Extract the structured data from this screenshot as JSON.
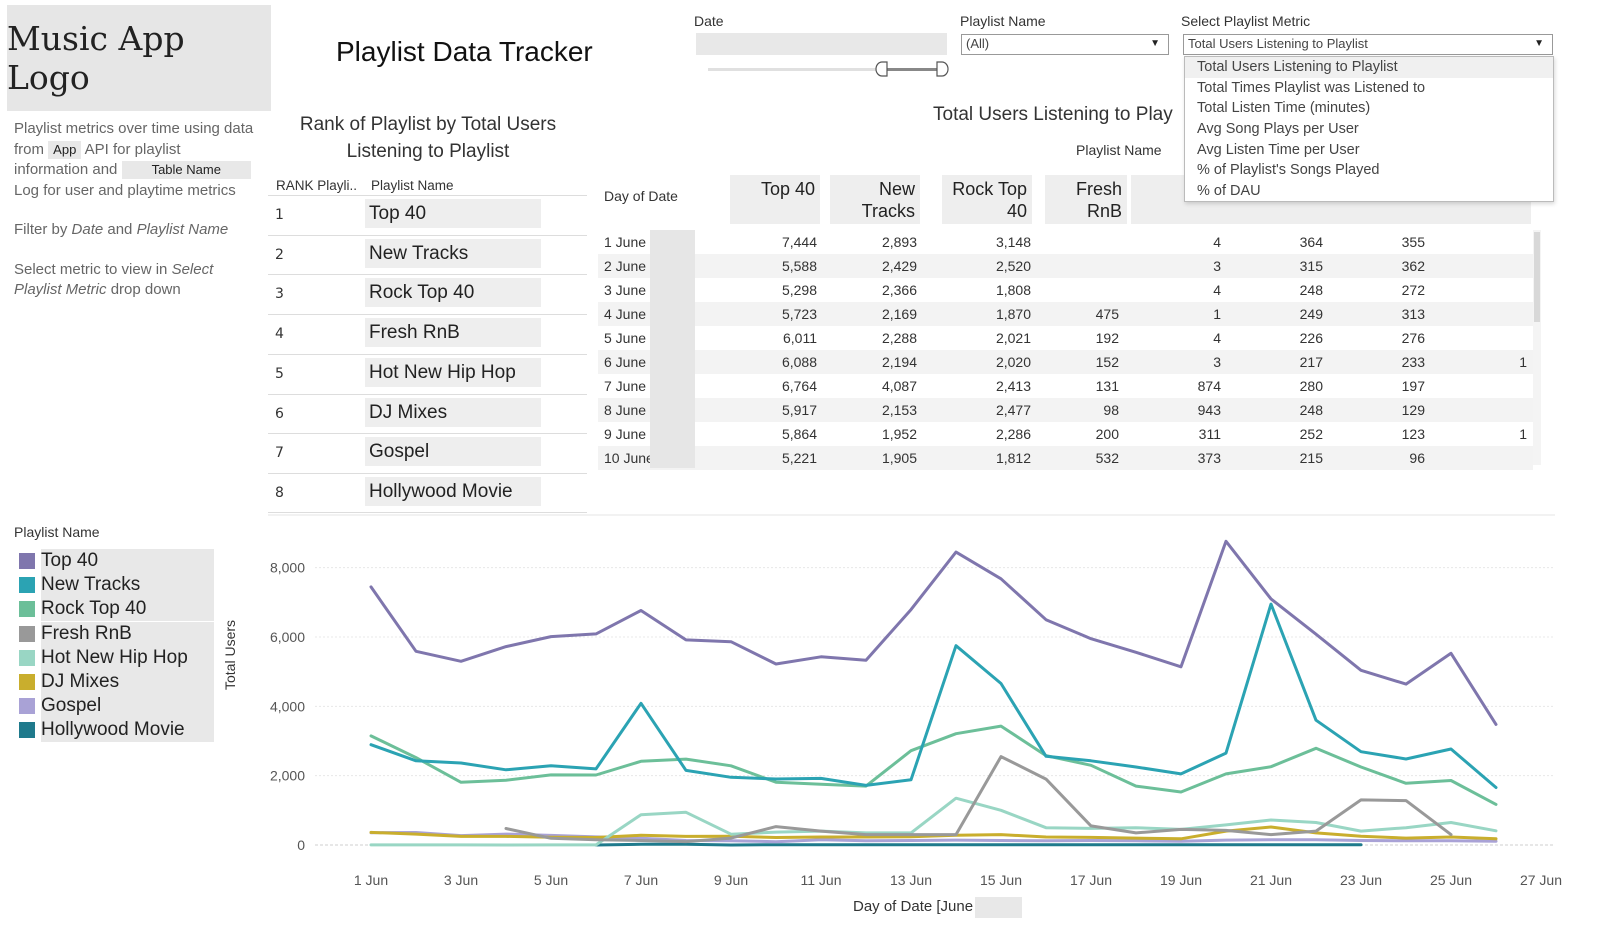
{
  "logo": {
    "text": "Music App Logo"
  },
  "title": "Playlist Data Tracker",
  "description": {
    "p1_a": "Playlist metrics over time using data from",
    "p1_chip1": "App",
    "p1_b": "API for playlist information and",
    "p1_chip2": "Table Name",
    "p1_c": "Log for user and playtime metrics",
    "p2_a": "Filter by",
    "p2_date": "Date",
    "p2_and": "and",
    "p2_pn": "Playlist Name",
    "p3_a": "Select metric to view in",
    "p3_sm": "Select Playlist Metric",
    "p3_b": "drop down"
  },
  "filters": {
    "date_label": "Date",
    "playlist_label": "Playlist Name",
    "playlist_value": "(All)",
    "metric_label": "Select Playlist Metric",
    "metric_value": "Total Users Listening to Playlist"
  },
  "metric_options": [
    "Total Users Listening to Playlist",
    "Total Times Playlist was Listened to",
    "Total Listen Time (minutes)",
    "Avg Song Plays per User",
    "Avg Listen Time per User",
    "% of Playlist's Songs Played",
    "% of DAU"
  ],
  "rank": {
    "title_l1": "Rank of Playlist by Total Users",
    "title_l2": "Listening to Playlist",
    "col_rank": "RANK Playli..",
    "col_name": "Playlist Name",
    "rows": [
      {
        "rank": "1",
        "name": "Top 40"
      },
      {
        "rank": "2",
        "name": "New Tracks"
      },
      {
        "rank": "3",
        "name": "Rock Top 40"
      },
      {
        "rank": "4",
        "name": "Fresh RnB"
      },
      {
        "rank": "5",
        "name": "Hot New Hip Hop"
      },
      {
        "rank": "6",
        "name": "DJ Mixes"
      },
      {
        "rank": "7",
        "name": "Gospel"
      },
      {
        "rank": "8",
        "name": "Hollywood Movie"
      }
    ]
  },
  "crosstab": {
    "title": "Total Users Listening to Play",
    "playlist_name_label": "Playlist Name",
    "day_label": "Day of Date",
    "col_headers": [
      [
        "Top 40"
      ],
      [
        "New",
        "Tracks"
      ],
      [
        "Rock Top",
        "40"
      ],
      [
        "Fresh",
        "RnB"
      ]
    ],
    "rows": [
      {
        "date": "1 June",
        "v": [
          "7,444",
          "2,893",
          "3,148",
          "",
          "4",
          "364",
          "355",
          ""
        ]
      },
      {
        "date": "2 June",
        "v": [
          "5,588",
          "2,429",
          "2,520",
          "",
          "3",
          "315",
          "362",
          ""
        ]
      },
      {
        "date": "3 June",
        "v": [
          "5,298",
          "2,366",
          "1,808",
          "",
          "4",
          "248",
          "272",
          ""
        ]
      },
      {
        "date": "4 June",
        "v": [
          "5,723",
          "2,169",
          "1,870",
          "475",
          "1",
          "249",
          "313",
          ""
        ]
      },
      {
        "date": "5 June",
        "v": [
          "6,011",
          "2,288",
          "2,021",
          "192",
          "4",
          "226",
          "276",
          ""
        ]
      },
      {
        "date": "6 June",
        "v": [
          "6,088",
          "2,194",
          "2,020",
          "152",
          "3",
          "217",
          "233",
          "1"
        ]
      },
      {
        "date": "7 June",
        "v": [
          "6,764",
          "4,087",
          "2,413",
          "131",
          "874",
          "280",
          "197",
          ""
        ]
      },
      {
        "date": "8 June",
        "v": [
          "5,917",
          "2,153",
          "2,477",
          "98",
          "943",
          "248",
          "129",
          ""
        ]
      },
      {
        "date": "9 June",
        "v": [
          "5,864",
          "1,952",
          "2,286",
          "200",
          "311",
          "252",
          "123",
          "1"
        ]
      },
      {
        "date": "10 June",
        "v": [
          "5,221",
          "1,905",
          "1,812",
          "532",
          "373",
          "215",
          "96",
          ""
        ]
      }
    ]
  },
  "legend": {
    "title": "Playlist Name",
    "items": [
      {
        "name": "Top 40",
        "color": "#7f76ad"
      },
      {
        "name": "New Tracks",
        "color": "#2ba3b3"
      },
      {
        "name": "Rock Top 40",
        "color": "#6cbf99"
      },
      {
        "name": "Fresh RnB",
        "color": "#999999"
      },
      {
        "name": "Hot New Hip Hop",
        "color": "#99d6c4"
      },
      {
        "name": "DJ Mixes",
        "color": "#c9ae2d"
      },
      {
        "name": "Gospel",
        "color": "#a9a2d6"
      },
      {
        "name": "Hollywood Movie",
        "color": "#1f7a8c"
      }
    ]
  },
  "chart_data": {
    "type": "line",
    "xlabel": "Day of Date [June",
    "ylabel": "Total Users",
    "ylim": [
      0,
      9000
    ],
    "yticks": [
      0,
      2000,
      4000,
      6000,
      8000
    ],
    "ytick_labels": [
      "0",
      "2,000",
      "4,000",
      "6,000",
      "8,000"
    ],
    "xlim": [
      0,
      27.5
    ],
    "xticks": [
      1,
      3,
      5,
      7,
      9,
      11,
      13,
      15,
      17,
      19,
      21,
      23,
      25,
      27
    ],
    "xtick_labels": [
      "1 Jun",
      "3 Jun",
      "5 Jun",
      "7 Jun",
      "9 Jun",
      "11 Jun",
      "13 Jun",
      "15 Jun",
      "17 Jun",
      "19 Jun",
      "21 Jun",
      "23 Jun",
      "25 Jun",
      "27 Jun"
    ],
    "series": [
      {
        "name": "Top 40",
        "color": "#7f76ad",
        "start": 1,
        "values": [
          7444,
          5588,
          5298,
          5723,
          6011,
          6088,
          6764,
          5917,
          5864,
          5221,
          5430,
          5330,
          6790,
          8450,
          7680,
          6500,
          5950,
          5560,
          5140,
          8760,
          7100,
          6080,
          5040,
          4640,
          5530,
          3480
        ]
      },
      {
        "name": "New Tracks",
        "color": "#2ba3b3",
        "start": 1,
        "values": [
          2893,
          2429,
          2366,
          2169,
          2288,
          2194,
          4087,
          2153,
          1952,
          1905,
          1920,
          1720,
          1880,
          5750,
          4660,
          2560,
          2430,
          2250,
          2050,
          2650,
          6950,
          3600,
          2690,
          2480,
          2770,
          1660
        ]
      },
      {
        "name": "Rock Top 40",
        "color": "#6cbf99",
        "start": 1,
        "values": [
          3148,
          2520,
          1808,
          1870,
          2021,
          2020,
          2413,
          2477,
          2286,
          1812,
          1750,
          1700,
          2720,
          3210,
          3430,
          2580,
          2300,
          1700,
          1530,
          2050,
          2260,
          2790,
          2250,
          1780,
          1860,
          1170
        ]
      },
      {
        "name": "Fresh RnB",
        "color": "#999999",
        "start": 4,
        "values": [
          475,
          192,
          152,
          131,
          98,
          200,
          532,
          400,
          300,
          300,
          300,
          2550,
          1900,
          550,
          350,
          450,
          420,
          300,
          400,
          1300,
          1280,
          300
        ]
      },
      {
        "name": "Hot New Hip Hop",
        "color": "#99d6c4",
        "start": 1,
        "values": [
          4,
          3,
          4,
          1,
          4,
          3,
          874,
          943,
          311,
          373,
          400,
          350,
          350,
          1350,
          1000,
          500,
          480,
          500,
          450,
          580,
          720,
          650,
          400,
          500,
          650,
          410
        ]
      },
      {
        "name": "DJ Mixes",
        "color": "#c9ae2d",
        "start": 1,
        "values": [
          364,
          315,
          248,
          249,
          226,
          217,
          280,
          248,
          252,
          215,
          230,
          230,
          240,
          280,
          300,
          230,
          220,
          200,
          180,
          400,
          520,
          350,
          250,
          200,
          230,
          180
        ]
      },
      {
        "name": "Gospel",
        "color": "#a9a2d6",
        "start": 1,
        "values": [
          355,
          362,
          272,
          313,
          276,
          233,
          197,
          129,
          123,
          96,
          150,
          120,
          130,
          140,
          130,
          120,
          130,
          120,
          110,
          140,
          150,
          150,
          130,
          120,
          120,
          110
        ]
      },
      {
        "name": "Hollywood Movie",
        "color": "#1f7a8c",
        "start": 6,
        "values": [
          1,
          20,
          20,
          1,
          10,
          10,
          10,
          10,
          10,
          10,
          10,
          10,
          10,
          10,
          10,
          10,
          10,
          10
        ]
      }
    ]
  }
}
